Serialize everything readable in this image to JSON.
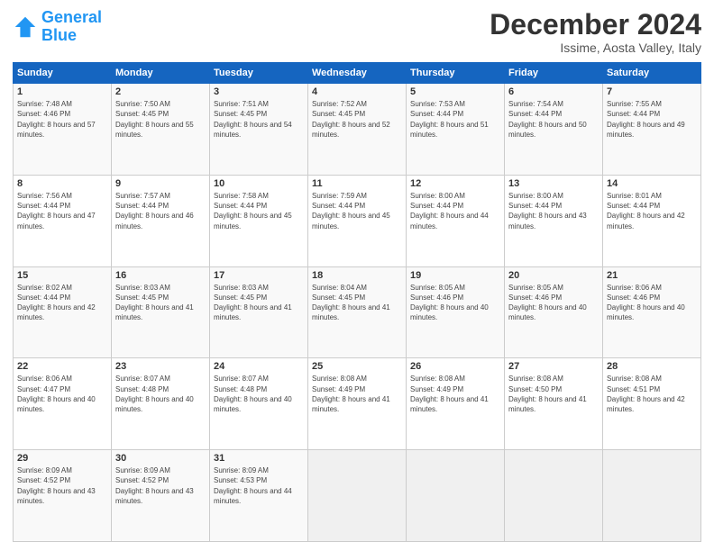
{
  "logo": {
    "line1": "General",
    "line2": "Blue"
  },
  "title": "December 2024",
  "subtitle": "Issime, Aosta Valley, Italy",
  "weekdays": [
    "Sunday",
    "Monday",
    "Tuesday",
    "Wednesday",
    "Thursday",
    "Friday",
    "Saturday"
  ],
  "weeks": [
    [
      {
        "day": "1",
        "sunrise": "7:48 AM",
        "sunset": "4:46 PM",
        "daylight": "8 hours and 57 minutes."
      },
      {
        "day": "2",
        "sunrise": "7:50 AM",
        "sunset": "4:45 PM",
        "daylight": "8 hours and 55 minutes."
      },
      {
        "day": "3",
        "sunrise": "7:51 AM",
        "sunset": "4:45 PM",
        "daylight": "8 hours and 54 minutes."
      },
      {
        "day": "4",
        "sunrise": "7:52 AM",
        "sunset": "4:45 PM",
        "daylight": "8 hours and 52 minutes."
      },
      {
        "day": "5",
        "sunrise": "7:53 AM",
        "sunset": "4:44 PM",
        "daylight": "8 hours and 51 minutes."
      },
      {
        "day": "6",
        "sunrise": "7:54 AM",
        "sunset": "4:44 PM",
        "daylight": "8 hours and 50 minutes."
      },
      {
        "day": "7",
        "sunrise": "7:55 AM",
        "sunset": "4:44 PM",
        "daylight": "8 hours and 49 minutes."
      }
    ],
    [
      {
        "day": "8",
        "sunrise": "7:56 AM",
        "sunset": "4:44 PM",
        "daylight": "8 hours and 47 minutes."
      },
      {
        "day": "9",
        "sunrise": "7:57 AM",
        "sunset": "4:44 PM",
        "daylight": "8 hours and 46 minutes."
      },
      {
        "day": "10",
        "sunrise": "7:58 AM",
        "sunset": "4:44 PM",
        "daylight": "8 hours and 45 minutes."
      },
      {
        "day": "11",
        "sunrise": "7:59 AM",
        "sunset": "4:44 PM",
        "daylight": "8 hours and 45 minutes."
      },
      {
        "day": "12",
        "sunrise": "8:00 AM",
        "sunset": "4:44 PM",
        "daylight": "8 hours and 44 minutes."
      },
      {
        "day": "13",
        "sunrise": "8:00 AM",
        "sunset": "4:44 PM",
        "daylight": "8 hours and 43 minutes."
      },
      {
        "day": "14",
        "sunrise": "8:01 AM",
        "sunset": "4:44 PM",
        "daylight": "8 hours and 42 minutes."
      }
    ],
    [
      {
        "day": "15",
        "sunrise": "8:02 AM",
        "sunset": "4:44 PM",
        "daylight": "8 hours and 42 minutes."
      },
      {
        "day": "16",
        "sunrise": "8:03 AM",
        "sunset": "4:45 PM",
        "daylight": "8 hours and 41 minutes."
      },
      {
        "day": "17",
        "sunrise": "8:03 AM",
        "sunset": "4:45 PM",
        "daylight": "8 hours and 41 minutes."
      },
      {
        "day": "18",
        "sunrise": "8:04 AM",
        "sunset": "4:45 PM",
        "daylight": "8 hours and 41 minutes."
      },
      {
        "day": "19",
        "sunrise": "8:05 AM",
        "sunset": "4:46 PM",
        "daylight": "8 hours and 40 minutes."
      },
      {
        "day": "20",
        "sunrise": "8:05 AM",
        "sunset": "4:46 PM",
        "daylight": "8 hours and 40 minutes."
      },
      {
        "day": "21",
        "sunrise": "8:06 AM",
        "sunset": "4:46 PM",
        "daylight": "8 hours and 40 minutes."
      }
    ],
    [
      {
        "day": "22",
        "sunrise": "8:06 AM",
        "sunset": "4:47 PM",
        "daylight": "8 hours and 40 minutes."
      },
      {
        "day": "23",
        "sunrise": "8:07 AM",
        "sunset": "4:48 PM",
        "daylight": "8 hours and 40 minutes."
      },
      {
        "day": "24",
        "sunrise": "8:07 AM",
        "sunset": "4:48 PM",
        "daylight": "8 hours and 40 minutes."
      },
      {
        "day": "25",
        "sunrise": "8:08 AM",
        "sunset": "4:49 PM",
        "daylight": "8 hours and 41 minutes."
      },
      {
        "day": "26",
        "sunrise": "8:08 AM",
        "sunset": "4:49 PM",
        "daylight": "8 hours and 41 minutes."
      },
      {
        "day": "27",
        "sunrise": "8:08 AM",
        "sunset": "4:50 PM",
        "daylight": "8 hours and 41 minutes."
      },
      {
        "day": "28",
        "sunrise": "8:08 AM",
        "sunset": "4:51 PM",
        "daylight": "8 hours and 42 minutes."
      }
    ],
    [
      {
        "day": "29",
        "sunrise": "8:09 AM",
        "sunset": "4:52 PM",
        "daylight": "8 hours and 43 minutes."
      },
      {
        "day": "30",
        "sunrise": "8:09 AM",
        "sunset": "4:52 PM",
        "daylight": "8 hours and 43 minutes."
      },
      {
        "day": "31",
        "sunrise": "8:09 AM",
        "sunset": "4:53 PM",
        "daylight": "8 hours and 44 minutes."
      },
      null,
      null,
      null,
      null
    ]
  ]
}
